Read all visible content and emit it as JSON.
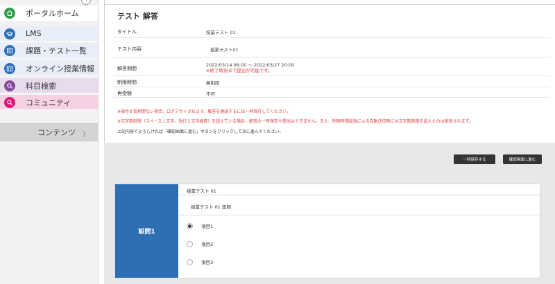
{
  "sidebar": {
    "items": [
      {
        "label": "ポータルホーム",
        "icon": "home-icon",
        "color": "#2e9e4a",
        "bg": "#ffffff"
      },
      {
        "label": "LMS",
        "icon": "graduation-cap-icon",
        "color": "#2e6fb4",
        "bg": "#e7eef8"
      },
      {
        "label": "課題・テスト一覧",
        "icon": "list-icon",
        "color": "#2e6fb4",
        "bg": "#e7eef8"
      },
      {
        "label": "オンライン授業情報",
        "icon": "calendar-icon",
        "color": "#2e6fb4",
        "bg": "#e7eef8"
      },
      {
        "label": "科目検索",
        "icon": "search-icon",
        "color": "#8a4a9c",
        "bg": "#e8dcec"
      },
      {
        "label": "コミュニティ",
        "icon": "community-search-icon",
        "color": "#d8197b",
        "bg": "#f6d1e3"
      }
    ],
    "content_menu": {
      "label": "コンテンツ",
      "chevron": "〉"
    },
    "collapse_symbol": "‹"
  },
  "panel": {
    "title": "テスト 解答",
    "rows": [
      {
        "label": "タイトル",
        "value": "授業テスト 01"
      },
      {
        "label": "テスト内容",
        "value": "授業テスト01"
      },
      {
        "label": "解答期間",
        "value": "2022/03/14 08:00 ～ 2022/03/27 20:00",
        "sub": "※終了時刻まで提出が可能です。"
      },
      {
        "label": "制限時間",
        "value": "無制限"
      },
      {
        "label": "再受験",
        "value": "不可"
      }
    ],
    "warnings": [
      "※操作が長期間ない場合、ログアウトされます。解答を継続するには一時保存してください。",
      "※文字数制限（スペース１文字、改行２文字換算）を超えている場合、解答の一時保存や提出はできません。また、制限時間超過による自動送信時には文字数制限を超えた分は削除されます。"
    ],
    "note": "上記内容でよろしければ「確認画面に進む」ボタンをクリックして次に進んでください。"
  },
  "actions": {
    "temp_save": "一時保存する",
    "confirm": "確認画面に進む"
  },
  "question": {
    "label": "設問1",
    "title": "授業テスト 01",
    "text": "授業テスト 01 設問",
    "options": [
      {
        "label": "項目1",
        "selected": true
      },
      {
        "label": "項目2",
        "selected": false
      },
      {
        "label": "項目3",
        "selected": false
      }
    ]
  }
}
